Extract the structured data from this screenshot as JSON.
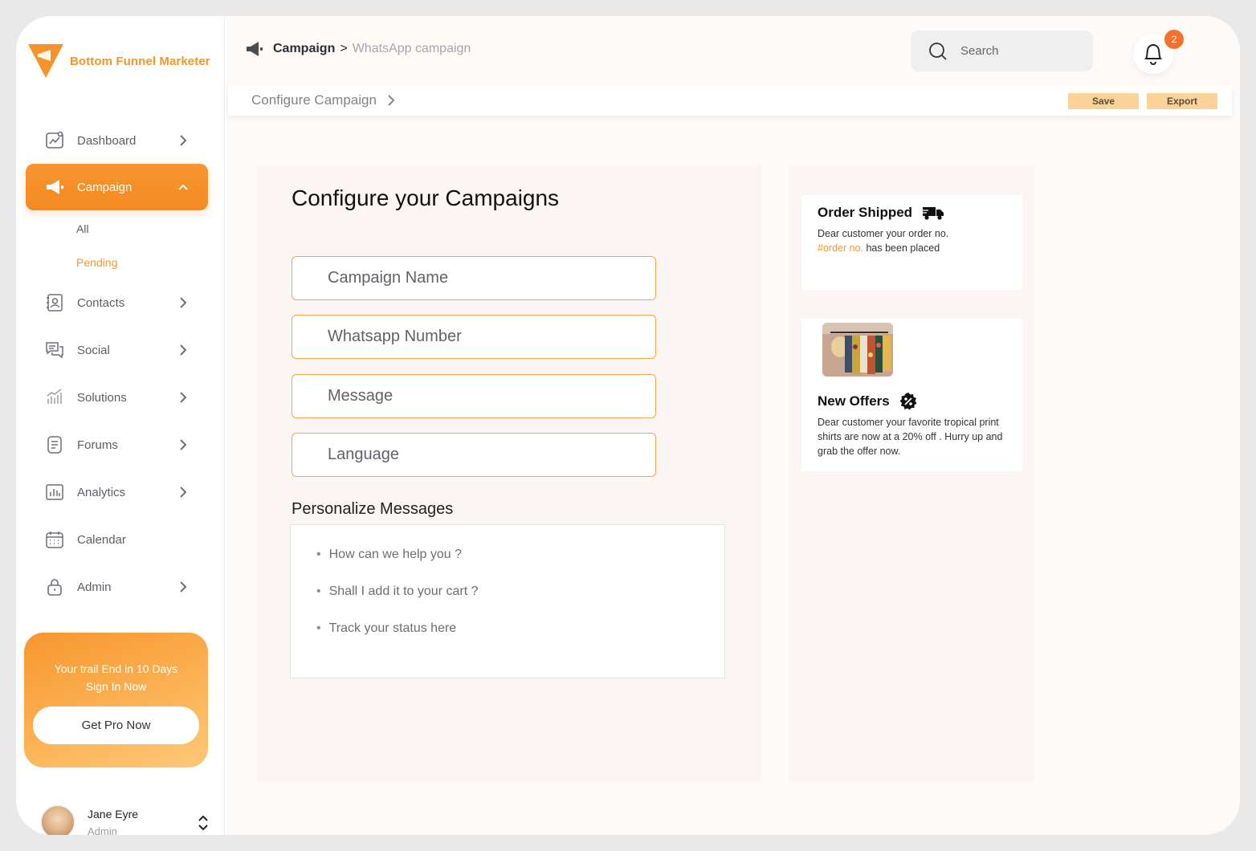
{
  "brand": {
    "name": "Bottom Funnel Marketer",
    "accent": "#f7922a"
  },
  "sidebar": {
    "items": [
      {
        "label": "Dashboard",
        "icon": "dashboard-chart-icon"
      },
      {
        "label": "Campaign",
        "icon": "megaphone-icon",
        "active": true
      },
      {
        "label": "Contacts",
        "icon": "contacts-icon"
      },
      {
        "label": "Social",
        "icon": "chat-bubbles-icon"
      },
      {
        "label": "Solutions",
        "icon": "bar-chart-icon"
      },
      {
        "label": "Forums",
        "icon": "document-icon"
      },
      {
        "label": "Analytics",
        "icon": "analytics-icon"
      },
      {
        "label": "Calendar",
        "icon": "calendar-icon"
      },
      {
        "label": "Admin",
        "icon": "lock-icon"
      }
    ],
    "campaign_sub": {
      "all": "All",
      "pending": "Pending"
    }
  },
  "trial": {
    "line1": "Your trail End in 10 Days",
    "line2": "Sign In Now",
    "button": "Get Pro Now"
  },
  "user": {
    "name": "Jane Eyre",
    "role": "Admin"
  },
  "header": {
    "breadcrumb_current": "Campaign",
    "breadcrumb_sep": ">",
    "breadcrumb_page": "WhatsApp campaign",
    "search_placeholder": "Search",
    "notification_count": "2"
  },
  "subbar": {
    "title": "Configure Campaign",
    "save": "Save",
    "export": "Export"
  },
  "form": {
    "title": "Configure your Campaigns",
    "fields": {
      "campaign_name": "Campaign Name",
      "whatsapp_number": "Whatsapp Number",
      "message": "Message",
      "language": "Language"
    },
    "personalize_title": "Personalize Messages",
    "personalize_items": [
      "How can we help you ?",
      "Shall I add it to your cart ?",
      "Track your status here"
    ]
  },
  "preview": {
    "order": {
      "title": "Order Shipped",
      "text_before": "Dear customer your order no.",
      "highlight": "#order no.",
      "text_after": " has been placed"
    },
    "offers": {
      "title": "New Offers",
      "text": "Dear customer your favorite tropical print shirts are now at a 20% off . Hurry up and grab the offer now."
    }
  }
}
